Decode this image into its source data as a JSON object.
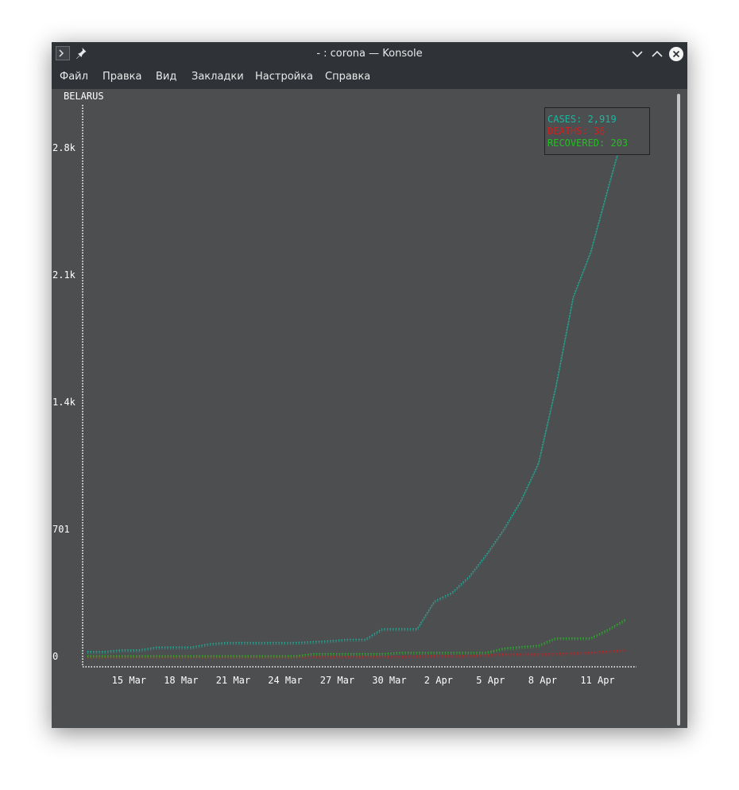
{
  "window": {
    "title": "- : corona — Konsole",
    "menu": [
      "Файл",
      "Правка",
      "Вид",
      "Закладки",
      "Настройка",
      "Справка"
    ]
  },
  "colors": {
    "cases": "#19b8a0",
    "deaths": "#d02020",
    "recovered": "#22c022",
    "axis": "#ffffff",
    "background": "#4d4e50",
    "titlebar": "#2f3337"
  },
  "chart_data": {
    "type": "line",
    "title": "BELARUS",
    "x": [
      "13 Mar",
      "14 Mar",
      "15 Mar",
      "16 Mar",
      "17 Mar",
      "18 Mar",
      "19 Mar",
      "20 Mar",
      "21 Mar",
      "22 Mar",
      "23 Mar",
      "24 Mar",
      "25 Mar",
      "26 Mar",
      "27 Mar",
      "28 Mar",
      "29 Mar",
      "30 Mar",
      "31 Mar",
      "1 Apr",
      "2 Apr",
      "3 Apr",
      "4 Apr",
      "5 Apr",
      "6 Apr",
      "7 Apr",
      "8 Apr",
      "9 Apr",
      "10 Apr",
      "11 Apr",
      "12 Apr",
      "13 Apr"
    ],
    "x_tick_labels": [
      "15 Mar",
      "18 Mar",
      "21 Mar",
      "24 Mar",
      "27 Mar",
      "30 Mar",
      "2 Apr",
      "5 Apr",
      "8 Apr",
      "11 Apr"
    ],
    "x_tick_positions": [
      2,
      5,
      8,
      11,
      14,
      17,
      20,
      23,
      26,
      29
    ],
    "y_tick_labels": [
      "0",
      "701",
      "1.4k",
      "2.1k",
      "2.8k"
    ],
    "y_tick_values": [
      0,
      701,
      1400,
      2100,
      2800
    ],
    "ylim": [
      0,
      3120
    ],
    "series": [
      {
        "name": "CASES",
        "values": [
          27,
          27,
          36,
          36,
          51,
          51,
          51,
          69,
          76,
          76,
          76,
          76,
          76,
          81,
          86,
          94,
          94,
          152,
          152,
          152,
          304,
          351,
          440,
          562,
          700,
          861,
          1066,
          1486,
          1981,
          2226,
          2578,
          2919
        ]
      },
      {
        "name": "DEATHS",
        "values": [
          0,
          0,
          0,
          0,
          0,
          0,
          0,
          0,
          0,
          0,
          0,
          0,
          0,
          0,
          0,
          0,
          0,
          0,
          0,
          2,
          4,
          4,
          5,
          8,
          13,
          13,
          13,
          16,
          19,
          23,
          29,
          36
        ]
      },
      {
        "name": "RECOVERED",
        "values": [
          3,
          3,
          3,
          3,
          3,
          3,
          3,
          3,
          3,
          3,
          3,
          3,
          3,
          15,
          15,
          15,
          15,
          15,
          22,
          22,
          22,
          22,
          22,
          22,
          45,
          53,
          61,
          101,
          101,
          101,
          148,
          203
        ]
      }
    ],
    "legend": {
      "position": "top-right",
      "entries": [
        {
          "label": "CASES: 2,919"
        },
        {
          "label": "DEATHS: 36"
        },
        {
          "label": "RECOVERED: 203"
        }
      ]
    },
    "grid": false
  }
}
